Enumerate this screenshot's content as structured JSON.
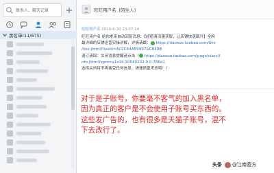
{
  "search": {
    "placeholder": "联系人、聊天记录"
  },
  "group": {
    "label": "黑名单(11/675)"
  },
  "chat": {
    "title": "旺旺用户名",
    "tag": "[陌生人]"
  },
  "message": {
    "sender": "旺旺用户名",
    "time": "2019-6-30 23:07:14",
    "line1a": "旺旺用户名 给你发来自动回复消息：【超值清流量获取，让店铺快速飙升】全网",
    "line2a": "最详细的店铺运营实操讲解，详情请戳：",
    "link1": "https://daoxue.taobao.com/live",
    "link1b": "/live.jhtml?liveId=AC2C64A59997&C849B",
    "line3a": "退订请回：关闭消息提醒请点击（",
    "link2": "https://daoxue.taobao.com/page/class/l",
    "link2b": "nfo.jhtml?spm=a1z14.10540232.0.0.786d1",
    "line4": "选择关闭将不再接受任何信息，请谨慎重考虑哦！）"
  },
  "annotation": {
    "line1": "对于是子账号，你要毫不客气的加入黑名单，",
    "line2": "因为真正的客户是不会使用子账号买东西的。",
    "line3": "这些发广告的，也有很多是天猫子账号，混不",
    "line4": "下去改行了。"
  },
  "watermark": {
    "brand": "头条",
    "handle": "@江南密方"
  },
  "colors": {
    "accent": "#e22b2b",
    "selected_group": "#dfeaf8",
    "link": "#2f6fc1"
  }
}
